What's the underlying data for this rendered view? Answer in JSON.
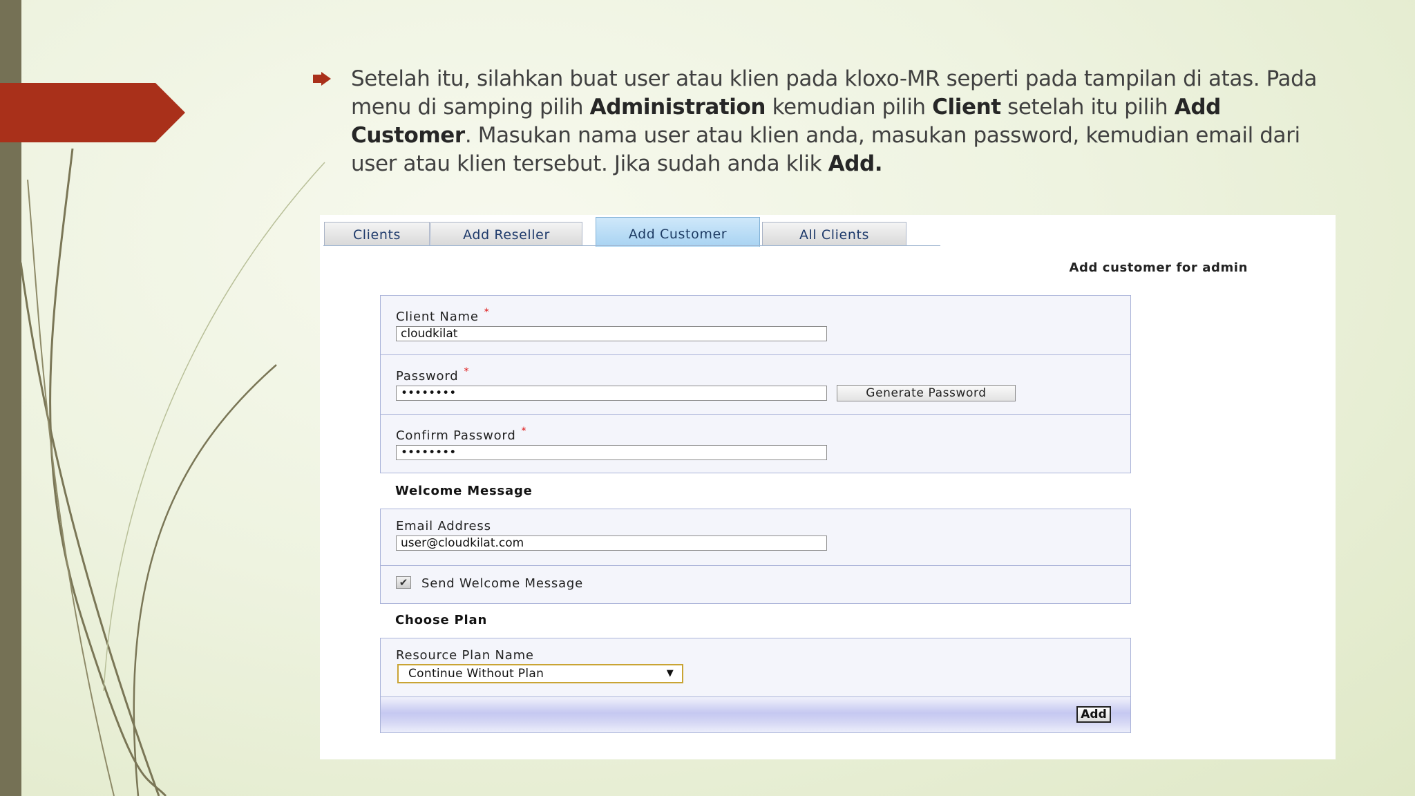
{
  "slide": {
    "bullet_icon": "arrow-bullet-icon",
    "text_segments": [
      {
        "t": "Setelah itu, silahkan buat user atau klien pada kloxo-MR seperti pada tampilan di atas. Pada menu di samping pilih ",
        "b": false
      },
      {
        "t": "Administration",
        "b": true
      },
      {
        "t": " kemudian pilih ",
        "b": false
      },
      {
        "t": "Client",
        "b": true
      },
      {
        "t": " setelah itu pilih ",
        "b": false
      },
      {
        "t": "Add Customer",
        "b": true
      },
      {
        "t": ". Masukan nama user atau klien anda, masukan password, kemudian email dari user atau klien tersebut. Jika sudah anda klik ",
        "b": false
      },
      {
        "t": "Add.",
        "b": true
      }
    ],
    "accent_color": "#a9301a",
    "bar_color": "#757155"
  },
  "tabs": [
    {
      "label": "Clients",
      "active": false
    },
    {
      "label": "Add Reseller",
      "active": false
    },
    {
      "label": "Add Customer",
      "active": true
    },
    {
      "label": "All Clients",
      "active": false
    }
  ],
  "form": {
    "title": "Add customer for admin",
    "client_name": {
      "label": "Client Name",
      "required": "*",
      "value": "cloudkilat"
    },
    "password": {
      "label": "Password",
      "required": "*",
      "value": "••••••••"
    },
    "generate_password_label": "Generate Password",
    "confirm_password": {
      "label": "Confirm Password",
      "required": "*",
      "value": "••••••••"
    },
    "welcome_section_title": "Welcome Message",
    "email": {
      "label": "Email Address",
      "value": "user@cloudkilat.com"
    },
    "send_welcome": {
      "label": "Send Welcome Message",
      "checked": true,
      "check_glyph": "✔"
    },
    "plan_section_title": "Choose Plan",
    "resource_plan": {
      "label": "Resource Plan Name",
      "value": "Continue Without Plan",
      "arrow": "▼"
    },
    "add_label": "Add"
  }
}
